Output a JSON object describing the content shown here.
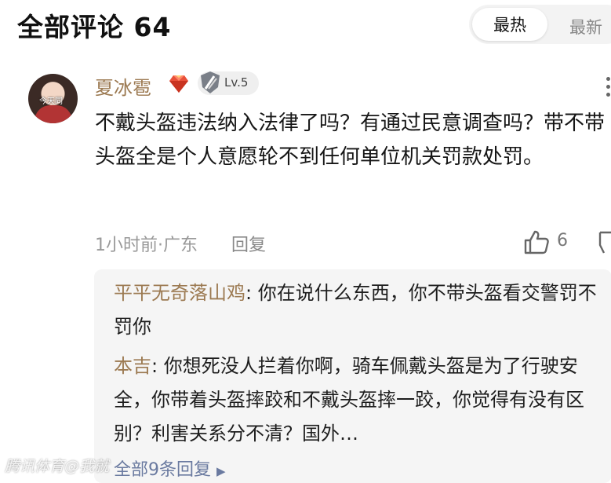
{
  "header": {
    "title": "全部评论 64",
    "sort_hot": "最热",
    "sort_new": "最新"
  },
  "comment": {
    "avatar_text": "今天同",
    "username": "夏冰雹",
    "level": "Lv.5",
    "text": "不戴头盔违法纳入法律了吗？有通过民意调查吗？带不带头盔全是个人意愿轮不到任何单位机关罚款处罚。",
    "time_location": "1小时前·广东",
    "reply_label": "回复",
    "like_count": "6"
  },
  "replies": [
    {
      "author": "平平无奇落山鸡",
      "separator": ": ",
      "text": "你在说什么东西，你不带头盔看交警罚不罚你"
    },
    {
      "author": "本吉",
      "separator": ": ",
      "text": "你想死没人拦着你啊，骑车佩戴头盔是为了行驶安全，你带着头盔摔跤和不戴头盔摔一跤，你觉得有没有区别？利害关系分不清？国外…"
    }
  ],
  "all_replies": "全部9条回复",
  "all_replies_arrow": "▶",
  "watermark": "腾讯体育@我就",
  "colors": {
    "username": "#9c7a52",
    "reply_bg": "#f5f5f5",
    "link": "#6a7aa0"
  }
}
